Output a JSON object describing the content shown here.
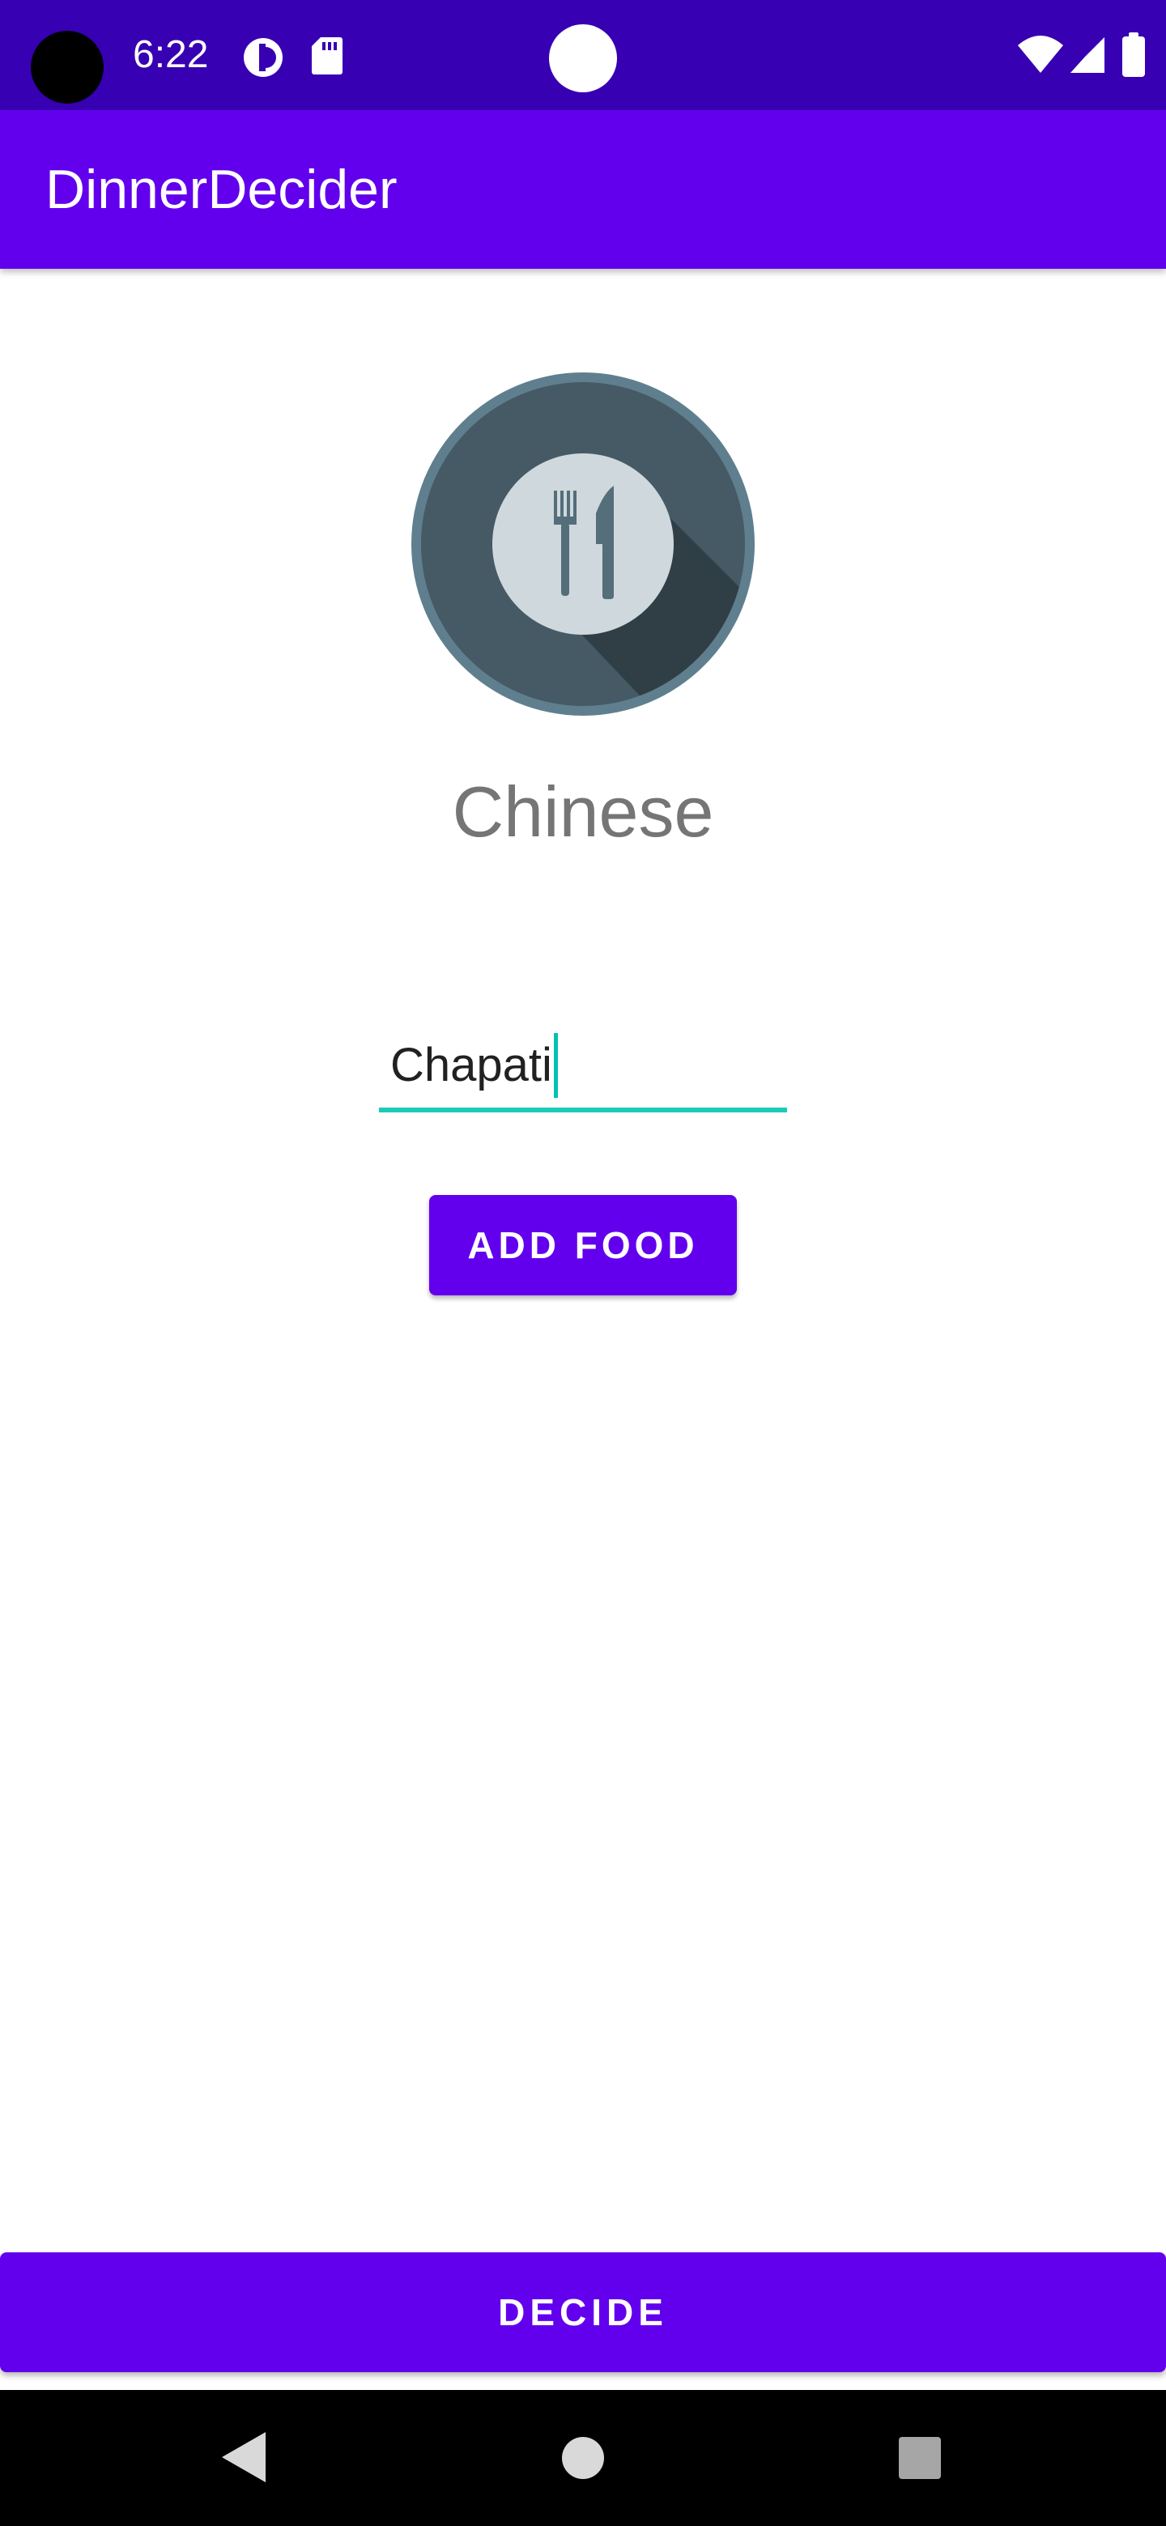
{
  "status_bar": {
    "time": "6:22",
    "icons": [
      "camera-hole",
      "data-saver-icon",
      "sd-card-icon",
      "wifi-icon",
      "cellular-signal-icon",
      "battery-icon"
    ],
    "background": "#3700b3"
  },
  "app_bar": {
    "title": "DinnerDecider",
    "background": "#6200ee"
  },
  "main": {
    "food_icon": "restaurant-icon",
    "selected_food": "Chinese",
    "add_food_input": {
      "value": "Chapati",
      "accent_color": "#1ec9b8"
    },
    "add_food_button_label": "ADD FOOD"
  },
  "footer": {
    "decide_button_label": "DECIDE"
  },
  "nav_bar": {
    "icons": [
      "back-icon",
      "home-icon",
      "recents-icon"
    ]
  },
  "colors": {
    "primary": "#6200ee",
    "primary_dark": "#3700b3",
    "text_secondary": "#757575",
    "accent": "#1ec9b8"
  }
}
